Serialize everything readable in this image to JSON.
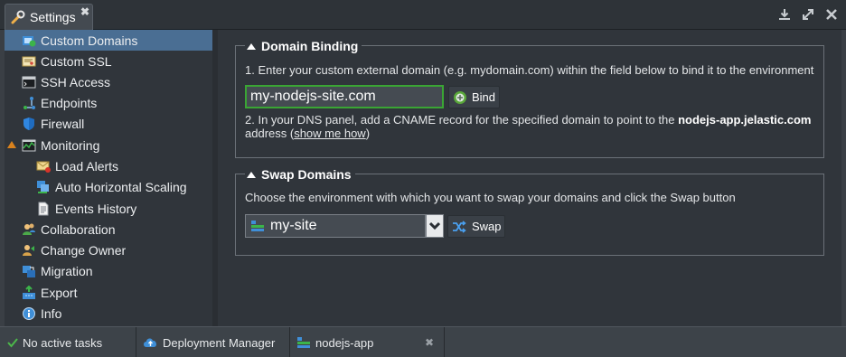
{
  "window": {
    "tab_title": "Settings",
    "close_glyph": "✖",
    "controls": [
      "download-icon",
      "expand-icon",
      "close-icon"
    ]
  },
  "sidebar": {
    "items": [
      {
        "label": "Custom Domains",
        "icon": "domains-icon",
        "active": true
      },
      {
        "label": "Custom SSL",
        "icon": "ssl-certificate-icon"
      },
      {
        "label": "SSH Access",
        "icon": "terminal-icon"
      },
      {
        "label": "Endpoints",
        "icon": "endpoints-icon"
      },
      {
        "label": "Firewall",
        "icon": "shield-icon"
      },
      {
        "label": "Monitoring",
        "icon": "monitoring-icon",
        "expanded": true
      },
      {
        "label": "Load Alerts",
        "icon": "alert-mail-icon"
      },
      {
        "label": "Auto Horizontal Scaling",
        "icon": "scaling-icon"
      },
      {
        "label": "Events History",
        "icon": "document-icon"
      },
      {
        "label": "Collaboration",
        "icon": "users-icon"
      },
      {
        "label": "Change Owner",
        "icon": "change-owner-icon"
      },
      {
        "label": "Migration",
        "icon": "migration-icon"
      },
      {
        "label": "Export",
        "icon": "export-icon"
      },
      {
        "label": "Info",
        "icon": "info-icon"
      }
    ]
  },
  "domain_binding": {
    "legend": "Domain Binding",
    "step1": "1. Enter your custom external domain (e.g. mydomain.com) within the field below to bind it to the environment",
    "domain_value": "my-nodejs-site.com",
    "bind_label": "Bind",
    "step2_prefix": "2. In your DNS panel, add a CNAME record for the specified domain to point to the ",
    "step2_domain": "nodejs-app.jelastic.com",
    "step2_line2_prefix": "address (",
    "show_me_how": "show me how",
    "step2_line2_suffix": ")"
  },
  "swap_domains": {
    "legend": "Swap Domains",
    "description": "Choose the environment with which you want to swap your domains and click the Swap button",
    "selected_env": "my-site",
    "swap_label": "Swap"
  },
  "statusbar": {
    "tasks": "No active tasks",
    "deployment_manager": "Deployment Manager",
    "env_tab": "nodejs-app",
    "close_glyph": "✖"
  },
  "colors": {
    "active_item": "#4a6e93",
    "focus_green": "#3aa534",
    "monitoring_orange": "#d9821e"
  }
}
